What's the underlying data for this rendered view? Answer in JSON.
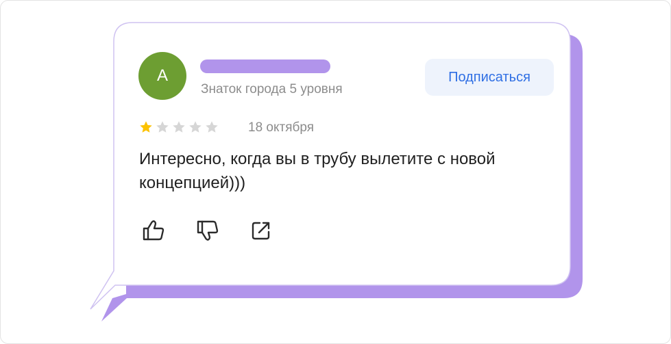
{
  "review": {
    "author_initial": "А",
    "author_level": "Знаток города 5 уровня",
    "subscribe_label": "Подписаться",
    "rating": 1,
    "rating_max": 5,
    "date": "18 октября",
    "text": "Интересно, когда вы в трубу вылетите с новой концепцией)))"
  },
  "icons": {
    "like": "thumbs-up-icon",
    "dislike": "thumbs-down-icon",
    "share": "share-icon"
  },
  "colors": {
    "avatar": "#6d9e32",
    "accent_purple": "#b194eb",
    "link_blue": "#2f6fe4",
    "star_filled": "#fcc200",
    "star_empty": "#d6d6d6"
  }
}
